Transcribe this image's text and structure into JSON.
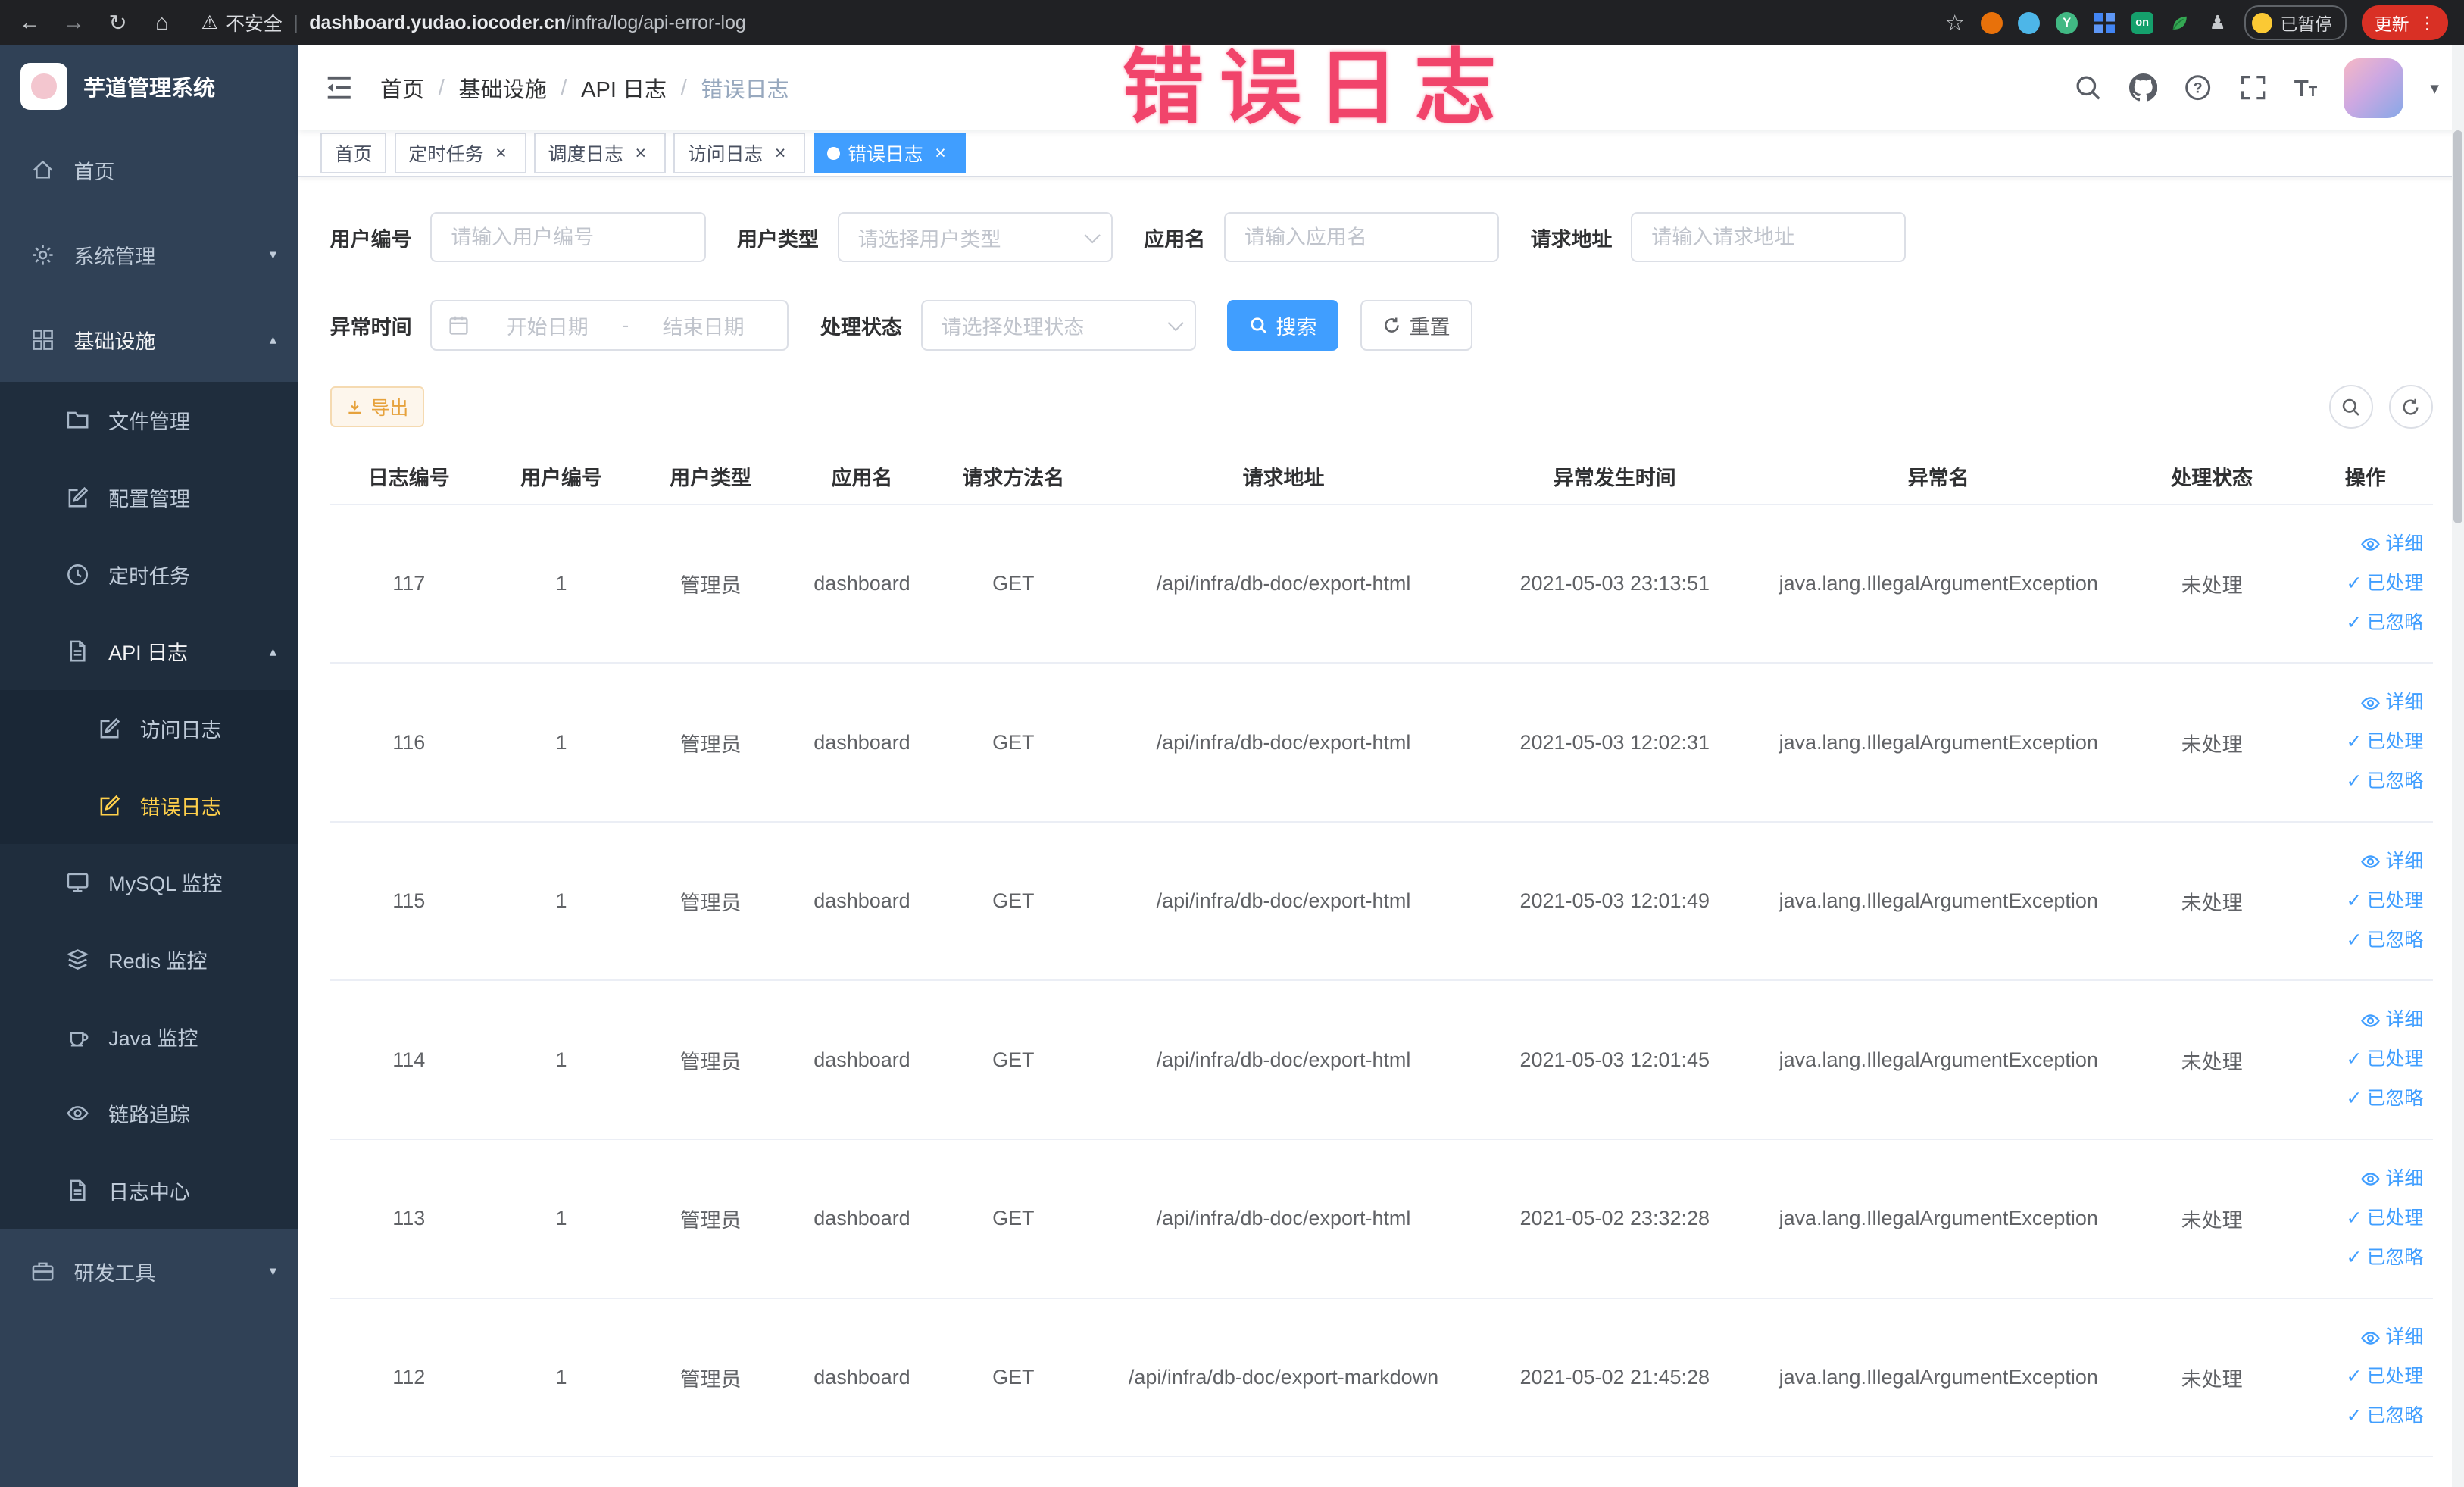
{
  "browser": {
    "security_label": "不安全",
    "url_domain": "dashboard.yudao.iocoder.cn",
    "url_path": "/infra/log/api-error-log",
    "extension_on_badge": "on",
    "profile_badge": "已暂停",
    "update_button": "更新"
  },
  "annotation": {
    "text": "错误日志"
  },
  "theme": {
    "primary": "#409eff",
    "sidebar_bg": "#304156",
    "sidebar_submenu_bg": "#1f2d3d",
    "sidebar_active_text": "#ffd04b",
    "warning_accent": "#e6a23c",
    "annotation_color": "#f1446b",
    "update_button_bg": "#d93025"
  },
  "sidebar": {
    "logo_title": "芋道管理系统",
    "items": {
      "home": "首页",
      "system_mgmt": "系统管理",
      "infrastructure": "基础设施",
      "file_mgmt": "文件管理",
      "config_mgmt": "配置管理",
      "scheduled_jobs": "定时任务",
      "api_logs": "API 日志",
      "access_log": "访问日志",
      "error_log": "错误日志",
      "mysql_monitor": "MySQL 监控",
      "redis_monitor": "Redis 监控",
      "java_monitor": "Java 监控",
      "trace": "链路追踪",
      "log_center": "日志中心",
      "dev_tools": "研发工具"
    }
  },
  "header": {
    "breadcrumb": [
      "首页",
      "基础设施",
      "API 日志",
      "错误日志"
    ]
  },
  "tabs": [
    {
      "label": "首页",
      "closable": false,
      "active": false
    },
    {
      "label": "定时任务",
      "closable": true,
      "active": false
    },
    {
      "label": "调度日志",
      "closable": true,
      "active": false
    },
    {
      "label": "访问日志",
      "closable": true,
      "active": false
    },
    {
      "label": "错误日志",
      "closable": true,
      "active": true
    }
  ],
  "filters": {
    "user_id_label": "用户编号",
    "user_id_placeholder": "请输入用户编号",
    "user_type_label": "用户类型",
    "user_type_placeholder": "请选择用户类型",
    "app_name_label": "应用名",
    "app_name_placeholder": "请输入应用名",
    "request_url_label": "请求地址",
    "request_url_placeholder": "请输入请求地址",
    "exception_time_label": "异常时间",
    "date_start_placeholder": "开始日期",
    "date_separator": "-",
    "date_end_placeholder": "结束日期",
    "status_label": "处理状态",
    "status_placeholder": "请选择处理状态",
    "search_button": "搜索",
    "reset_button": "重置"
  },
  "toolbar": {
    "export_button": "导出"
  },
  "table": {
    "columns": [
      "日志编号",
      "用户编号",
      "用户类型",
      "应用名",
      "请求方法名",
      "请求地址",
      "异常发生时间",
      "异常名",
      "处理状态",
      "操作"
    ],
    "actions": {
      "detail": "详细",
      "processed": "已处理",
      "ignored": "已忽略"
    },
    "rows": [
      {
        "log_id": "117",
        "user_id": "1",
        "user_type": "管理员",
        "app_name": "dashboard",
        "method": "GET",
        "url": "/api/infra/db-doc/export-html",
        "time": "2021-05-03 23:13:51",
        "exception": "java.lang.IllegalArgumentException",
        "status": "未处理"
      },
      {
        "log_id": "116",
        "user_id": "1",
        "user_type": "管理员",
        "app_name": "dashboard",
        "method": "GET",
        "url": "/api/infra/db-doc/export-html",
        "time": "2021-05-03 12:02:31",
        "exception": "java.lang.IllegalArgumentException",
        "status": "未处理"
      },
      {
        "log_id": "115",
        "user_id": "1",
        "user_type": "管理员",
        "app_name": "dashboard",
        "method": "GET",
        "url": "/api/infra/db-doc/export-html",
        "time": "2021-05-03 12:01:49",
        "exception": "java.lang.IllegalArgumentException",
        "status": "未处理"
      },
      {
        "log_id": "114",
        "user_id": "1",
        "user_type": "管理员",
        "app_name": "dashboard",
        "method": "GET",
        "url": "/api/infra/db-doc/export-html",
        "time": "2021-05-03 12:01:45",
        "exception": "java.lang.IllegalArgumentException",
        "status": "未处理"
      },
      {
        "log_id": "113",
        "user_id": "1",
        "user_type": "管理员",
        "app_name": "dashboard",
        "method": "GET",
        "url": "/api/infra/db-doc/export-html",
        "time": "2021-05-02 23:32:28",
        "exception": "java.lang.IllegalArgumentException",
        "status": "未处理"
      },
      {
        "log_id": "112",
        "user_id": "1",
        "user_type": "管理员",
        "app_name": "dashboard",
        "method": "GET",
        "url": "/api/infra/db-doc/export-markdown",
        "time": "2021-05-02 21:45:28",
        "exception": "java.lang.IllegalArgumentException",
        "status": "未处理"
      }
    ]
  }
}
